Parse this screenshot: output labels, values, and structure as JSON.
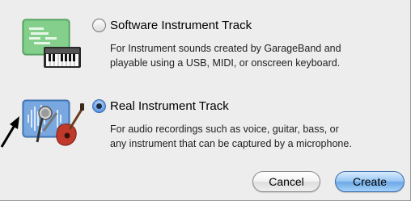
{
  "options": [
    {
      "title": "Software Instrument Track",
      "selected": false,
      "icon": "keyboard-icon",
      "description_lines": [
        "For Instrument sounds created by GarageBand and",
        "playable using a USB, MIDI, or onscreen keyboard."
      ]
    },
    {
      "title": "Real Instrument Track",
      "selected": true,
      "icon": "microphone-guitar-icon",
      "description_lines": [
        "For audio recordings such as voice, guitar, bass, or",
        "any instrument that can be captured by a microphone."
      ]
    }
  ],
  "buttons": {
    "cancel": "Cancel",
    "create": "Create"
  },
  "colors": {
    "default_button": "#8fc2f2",
    "radio_selected": "#3b7ad3",
    "software_icon_bg": "#6fc07a",
    "real_icon_bg": "#5b8fd0"
  }
}
